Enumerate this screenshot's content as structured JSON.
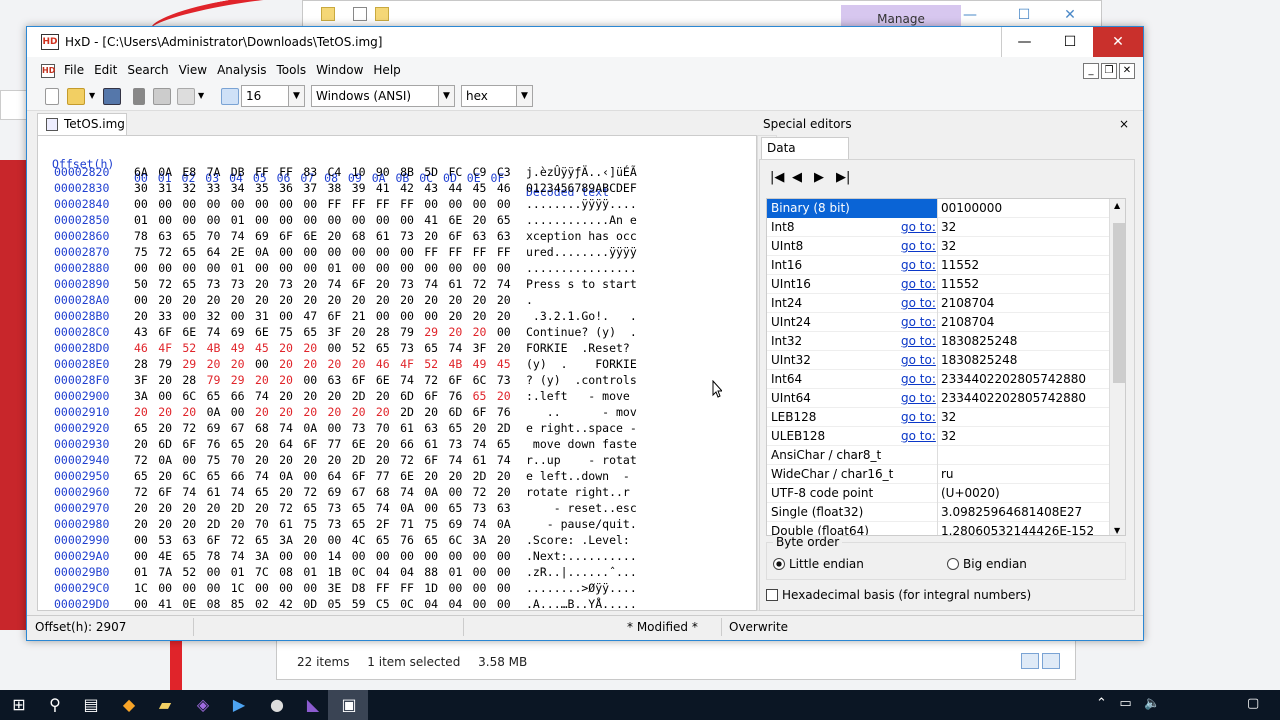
{
  "background": {
    "explorer_tab": "Manage",
    "explorer_status": {
      "items": "22 items",
      "selected": "1 item selected",
      "size": "3.58 MB"
    }
  },
  "window": {
    "title": "HxD - [C:\\Users\\Administrator\\Downloads\\TetOS.img]",
    "controls": {
      "minimize": "—",
      "maximize": "☐",
      "close": "✕"
    }
  },
  "menu": [
    "File",
    "Edit",
    "Search",
    "View",
    "Analysis",
    "Tools",
    "Window",
    "Help"
  ],
  "toolbar": {
    "bytes_per_row": "16",
    "charset": "Windows (ANSI)",
    "display": "hex"
  },
  "document_tab": "TetOS.img",
  "hex_view": {
    "header_offset": "Offset(h)",
    "header_columns": "00 01 02 03 04 05 06 07 08 09 0A 0B 0C 0D 0E 0F",
    "header_text": "Decoded text",
    "rows": [
      {
        "offset": "00002820",
        "bytes": "6A 0A E8 7A DB FF FF 83 C4 10 90 8B 5D FC C9 C3",
        "text": "j.èzÛÿÿƒÄ..‹]üÉÃ"
      },
      {
        "offset": "00002830",
        "bytes": "30 31 32 33 34 35 36 37 38 39 41 42 43 44 45 46",
        "text": "0123456789ABCDEF"
      },
      {
        "offset": "00002840",
        "bytes": "00 00 00 00 00 00 00 00 FF FF FF FF 00 00 00 00",
        "text": "........ÿÿÿÿ...."
      },
      {
        "offset": "00002850",
        "bytes": "01 00 00 00 01 00 00 00 00 00 00 00 41 6E 20 65",
        "text": "............An e"
      },
      {
        "offset": "00002860",
        "bytes": "78 63 65 70 74 69 6F 6E 20 68 61 73 20 6F 63 63",
        "text": "xception has occ"
      },
      {
        "offset": "00002870",
        "bytes": "75 72 65 64 2E 0A 00 00 00 00 00 00 FF FF FF FF",
        "text": "ured........ÿÿÿÿ"
      },
      {
        "offset": "00002880",
        "bytes": "00 00 00 00 01 00 00 00 01 00 00 00 00 00 00 00",
        "text": "................"
      },
      {
        "offset": "00002890",
        "bytes": "50 72 65 73 73 20 73 20 74 6F 20 73 74 61 72 74",
        "text": "Press s to start"
      },
      {
        "offset": "000028A0",
        "bytes": "00 20 20 20 20 20 20 20 20 20 20 20 20 20 20 20",
        "text": "."
      },
      {
        "offset": "000028B0",
        "bytes": "20 33 00 32 00 31 00 47 6F 21 00 00 00 20 20 20",
        "text": " .3.2.1.Go!.   ."
      },
      {
        "offset": "000028C0",
        "bytes": "43 6F 6E 74 69 6E 75 65 3F 20 28 79 29 20 20 00",
        "text": "Continue? (y)  ."
      },
      {
        "offset": "000028D0",
        "bytes": "46 4F 52 4B 49 45 20 20 00 52 65 73 65 74 3F 20",
        "text": "FORKIE  .Reset? "
      },
      {
        "offset": "000028E0",
        "bytes": "28 79 29 20 20 00 20 20 20 20 46 4F 52 4B 49 45",
        "text": "(y)  .    FORKIE"
      },
      {
        "offset": "000028F0",
        "bytes": "3F 20 28 79 29 20 20 00 63 6F 6E 74 72 6F 6C 73",
        "text": "? (y)  .controls"
      },
      {
        "offset": "00002900",
        "bytes": "3A 00 6C 65 66 74 20 20 20 2D 20 6D 6F 76 65 20",
        "text": ":.left   - move "
      },
      {
        "offset": "00002910",
        "bytes": "20 20 20 0A 00 20 20 20 20 20 20 2D 20 6D 6F 76",
        "text": "   ..      - mov"
      },
      {
        "offset": "00002920",
        "bytes": "65 20 72 69 67 68 74 0A 00 73 70 61 63 65 20 2D",
        "text": "e right..space -"
      },
      {
        "offset": "00002930",
        "bytes": "20 6D 6F 76 65 20 64 6F 77 6E 20 66 61 73 74 65",
        "text": " move down faste"
      },
      {
        "offset": "00002940",
        "bytes": "72 0A 00 75 70 20 20 20 20 2D 20 72 6F 74 61 74",
        "text": "r..up    - rotat"
      },
      {
        "offset": "00002950",
        "bytes": "65 20 6C 65 66 74 0A 00 64 6F 77 6E 20 20 2D 20",
        "text": "e left..down  - "
      },
      {
        "offset": "00002960",
        "bytes": "72 6F 74 61 74 65 20 72 69 67 68 74 0A 00 72 20",
        "text": "rotate right..r "
      },
      {
        "offset": "00002970",
        "bytes": "20 20 20 20 2D 20 72 65 73 65 74 0A 00 65 73 63",
        "text": "    - reset..esc"
      },
      {
        "offset": "00002980",
        "bytes": "20 20 20 2D 20 70 61 75 73 65 2F 71 75 69 74 0A",
        "text": "   - pause/quit."
      },
      {
        "offset": "00002990",
        "bytes": "00 53 63 6F 72 65 3A 20 00 4C 65 76 65 6C 3A 20",
        "text": ".Score: .Level: "
      },
      {
        "offset": "000029A0",
        "bytes": "00 4E 65 78 74 3A 00 00 14 00 00 00 00 00 00 00",
        "text": ".Next:.........."
      },
      {
        "offset": "000029B0",
        "bytes": "01 7A 52 00 01 7C 08 01 1B 0C 04 04 88 01 00 00",
        "text": ".zR..|......ˆ..."
      },
      {
        "offset": "000029C0",
        "bytes": "1C 00 00 00 1C 00 00 00 3E D8 FF FF 1D 00 00 00",
        "text": "........>Øÿÿ...."
      },
      {
        "offset": "000029D0",
        "bytes": "00 41 0E 08 85 02 42 0D 05 59 C5 0C 04 04 00 00",
        "text": ".A...…B..YÅ....."
      }
    ]
  },
  "special_editors": {
    "title": "Special editors",
    "close": "×",
    "tab": "Data inspector",
    "go_label": "go to:",
    "rows": [
      {
        "name": "Binary (8 bit)",
        "go": false,
        "value": "00100000"
      },
      {
        "name": "Int8",
        "go": true,
        "value": "32"
      },
      {
        "name": "UInt8",
        "go": true,
        "value": "32"
      },
      {
        "name": "Int16",
        "go": true,
        "value": "11552"
      },
      {
        "name": "UInt16",
        "go": true,
        "value": "11552"
      },
      {
        "name": "Int24",
        "go": true,
        "value": "2108704"
      },
      {
        "name": "UInt24",
        "go": true,
        "value": "2108704"
      },
      {
        "name": "Int32",
        "go": true,
        "value": "1830825248"
      },
      {
        "name": "UInt32",
        "go": true,
        "value": "1830825248"
      },
      {
        "name": "Int64",
        "go": true,
        "value": "2334402202805742880"
      },
      {
        "name": "UInt64",
        "go": true,
        "value": "2334402202805742880"
      },
      {
        "name": "LEB128",
        "go": true,
        "value": "32"
      },
      {
        "name": "ULEB128",
        "go": true,
        "value": "32"
      },
      {
        "name": "AnsiChar / char8_t",
        "go": false,
        "value": ""
      },
      {
        "name": "WideChar / char16_t",
        "go": false,
        "value": "ru"
      },
      {
        "name": "UTF-8 code point",
        "go": false,
        "value": " (U+0020)"
      },
      {
        "name": "Single (float32)",
        "go": false,
        "value": "3.09825964681408E27"
      },
      {
        "name": "Double (float64)",
        "go": false,
        "value": "1.28060532144426E-152"
      }
    ],
    "byte_order_label": "Byte order",
    "little_endian": "Little endian",
    "big_endian": "Big endian",
    "hex_basis": "Hexadecimal basis (for integral numbers)"
  },
  "status": {
    "offset": "Offset(h): 2907",
    "modified": "* Modified *",
    "mode": "Overwrite"
  }
}
